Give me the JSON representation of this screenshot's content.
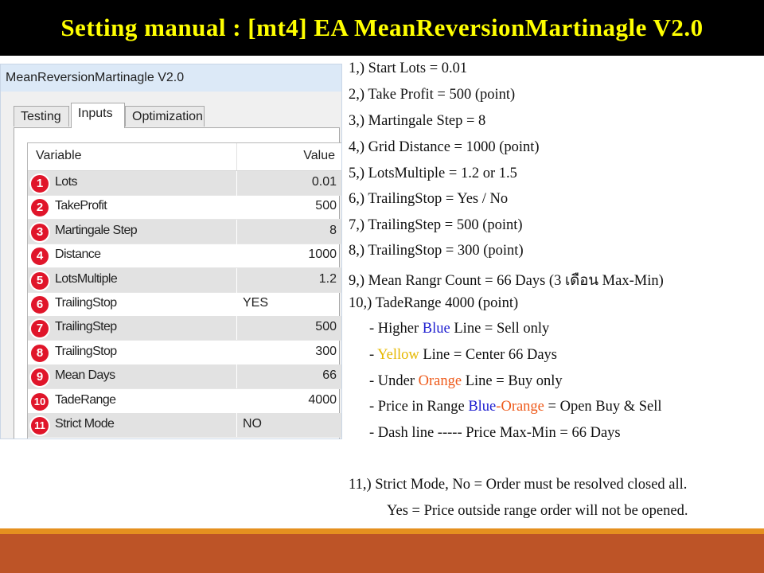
{
  "banner": {
    "title": "Setting manual : [mt4] EA MeanReversionMartinagle  V2.0"
  },
  "dialog": {
    "title": "MeanReversionMartinagle V2.0",
    "tabs": [
      {
        "label": "Testing",
        "active": false
      },
      {
        "label": "Inputs",
        "active": true
      },
      {
        "label": "Optimization",
        "active": false
      }
    ],
    "grid": {
      "headers": {
        "variable": "Variable",
        "value": "Value"
      },
      "rows": [
        {
          "num": "1",
          "name": "Lots",
          "value": "0.01",
          "align": "right"
        },
        {
          "num": "2",
          "name": "TakeProfit",
          "value": "500",
          "align": "right"
        },
        {
          "num": "3",
          "name": "Martingale Step",
          "value": "8",
          "align": "right"
        },
        {
          "num": "4",
          "name": "Distance",
          "value": "1000",
          "align": "right"
        },
        {
          "num": "5",
          "name": "LotsMultiple",
          "value": "1.2",
          "align": "right"
        },
        {
          "num": "6",
          "name": "TrailingStop",
          "value": "YES",
          "align": "left"
        },
        {
          "num": "7",
          "name": "TrailingStep",
          "value": "500",
          "align": "right"
        },
        {
          "num": "8",
          "name": "TrailingStop",
          "value": "300",
          "align": "right"
        },
        {
          "num": "9",
          "name": "Mean Days",
          "value": "66",
          "align": "right"
        },
        {
          "num": "10",
          "name": "TadeRange",
          "value": "4000",
          "align": "right"
        },
        {
          "num": "11",
          "name": "Strict Mode",
          "value": "NO",
          "align": "left"
        }
      ]
    }
  },
  "notes": {
    "l1": "1,) Start Lots = 0.01",
    "l2": "2,) Take Profit = 500 (point)",
    "l3": "3,) Martingale Step = 8",
    "l4": "4,) Grid Distance = 1000 (point)",
    "l5": "5,) LotsMultiple = 1.2 or 1.5",
    "l6": "6,) TrailingStop  = Yes / No",
    "l7": "7,) TrailingStep = 500 (point)",
    "l8": "8,) TrailingStop = 300 (point)",
    "l9": "9,) Mean Rangr Count = 66 Days (3 เดือน Max-Min)",
    "l10": "10,) TadeRange 4000 (point)",
    "s1": {
      "a": "- Higher ",
      "b": "Blue",
      "c": " Line = Sell only"
    },
    "s2": {
      "a": "- ",
      "b": "Yellow",
      "c": " Line = Center 66 Days"
    },
    "s3": {
      "a": "- Under ",
      "b": "Orange",
      "c": " Line = Buy only"
    },
    "s4": {
      "a": "- Price in Range ",
      "b": "Blue",
      "dash": "-",
      "c": "Orange",
      "d": " = Open Buy & Sell"
    },
    "s5": "- Dash line ----- Price Max-Min = 66 Days",
    "l11": "11,) Strict Mode, No = Order must be resolved closed all.",
    "l11b": "Yes = Price outside range order will not be opened."
  },
  "colors": {
    "banner_bg": "#000000",
    "banner_text": "#ffff00",
    "badge": "#e0152a",
    "blue": "#1f1fd0",
    "yellow": "#e6b800",
    "orange": "#ee5a1a",
    "footer_accent": "#e5901f",
    "footer_bg": "#bd5427"
  }
}
